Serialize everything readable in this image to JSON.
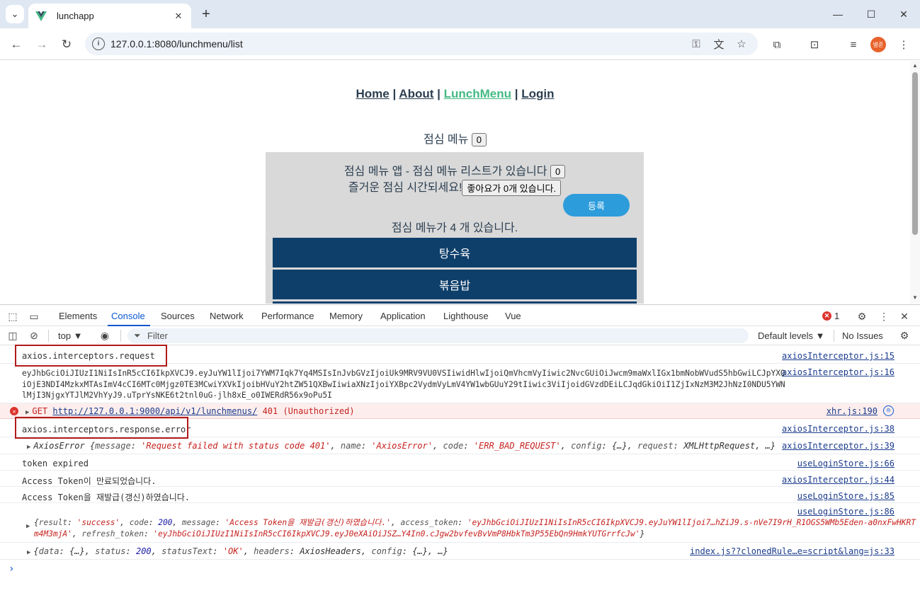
{
  "browser": {
    "tab_title": "lunchapp",
    "url": "127.0.0.1:8080/lunchmenu/list",
    "profile_initials": "병준"
  },
  "page": {
    "nav": [
      "Home",
      "About",
      "LunchMenu",
      "Login"
    ],
    "nav_separator": "|",
    "menu_title": "점심 메뉴",
    "menu_title_count": "0",
    "panel_line1": "점심 메뉴 앱 - 점심 메뉴 리스트가 있습니다",
    "panel_line1_count": "0",
    "panel_line2": "즐거운 점심 시간되세요!",
    "like_button": "좋아요가 0개 있습니다.",
    "register_button": "등록",
    "count_text": "점심 메뉴가 4 개 있습니다.",
    "menu_items": [
      "탕수육",
      "볶음밥"
    ]
  },
  "devtools": {
    "tabs": [
      "Elements",
      "Console",
      "Sources",
      "Network",
      "Performance",
      "Memory",
      "Application",
      "Lighthouse",
      "Vue"
    ],
    "active_tab": "Console",
    "error_count": "1",
    "context": "top ▼",
    "filter_placeholder": "Filter",
    "levels": "Default levels ▼",
    "issues": "No Issues",
    "rows": {
      "r1": {
        "msg": "axios.interceptors.request",
        "src": "axiosInterceptor.js:15"
      },
      "r2": {
        "msg": "eyJhbGciOiJIUzI1NiIsInR5cCI6IkpXVCJ9.eyJuYW1lIjoi7YWM7Iqk7Yq4MSIsInJvbGVzIjoiUk9MRV9VU0VSIiwidHlwIjoiQmVhcmVyIiwic2NvcGUiOiJwcm9maWxlIGx1bmNobWVudS5hbGwiLCJpYXQiOjE3NDI4MzkxMTAsImV4cCI6MTc0Mjgz0TE3MCwiYXVkIjoibHVuY2htZW51QXBwIiwiaXNzIjoiYXBpc2VydmVyLmV4YW1wbGUuY29tIiwic3ViIjoidGVzdDEiLCJqdGkiOiI1ZjIxNzM3M2JhNzI0NDU5YWNlMjI3NjgxYTJlM2VhYyJ9.uTprYsNKE6t2tnl0uG-jlh8xE_o0IWERdR56x9oPu5I",
        "src": "axiosInterceptor.js:16"
      },
      "r3": {
        "prefix": "GET",
        "link": "http://127.0.0.1:9000/api/v1/lunchmenus/",
        "status": "401 (Unauthorized)",
        "src": "xhr.js:190"
      },
      "r4": {
        "msg": "axios.interceptors.response.error",
        "src": "axiosInterceptor.js:38"
      },
      "r5": {
        "name": "AxiosError",
        "k1": "message",
        "v1": "'Request failed with status code 401'",
        "k2": "name",
        "v2": "'AxiosError'",
        "k3": "code",
        "v3": "'ERR_BAD_REQUEST'",
        "k4": "config",
        "v4": "{…}",
        "k5": "request",
        "v5": "XMLHttpRequest",
        "tail": "…}",
        "src": "axiosInterceptor.js:39"
      },
      "r6": {
        "msg": "token expired",
        "src": "useLoginStore.js:66"
      },
      "r7": {
        "msg": "Access Token이 만료되었습니다.",
        "src": "axiosInterceptor.js:44"
      },
      "r8": {
        "msg": "Access Token을 재발급(갱신)하였습니다.",
        "src": "useLoginStore.js:85"
      },
      "r9": {
        "src": "useLoginStore.js:86",
        "k1": "result",
        "v1": "'success'",
        "k2": "code",
        "v2": "200",
        "k3": "message",
        "v3": "'Access Token을 재발급(갱신)하였습니다.'",
        "k4": "access_token",
        "v4": "'eyJhbGciOiJIUzI1NiIsInR5cCI6IkpXVCJ9.eyJuYW1lIjoi7…hZiJ9.s-nVe7I9rH_R1OGS5WMb5Eden-a0nxFwHKRTm4M3mjA'",
        "k5": "refresh_token",
        "v5": "'eyJhbGciOiJIUzI1NiIsInR5cCI6IkpXVCJ9.eyJ0eXAiOiJSZ…Y4In0.cJgw2bvfevBvVmP8HbkTm3P55EbQn9HmkYUTGrrfcJw'"
      },
      "r10": {
        "k1": "data",
        "v1": "{…}",
        "k2": "status",
        "v2": "200",
        "k3": "statusText",
        "v3": "'OK'",
        "k4": "headers",
        "v4": "AxiosHeaders",
        "k5": "config",
        "v5": "{…}",
        "tail": "…}",
        "src": "index.js??clonedRule…e=script&lang=js:33"
      }
    }
  },
  "colors": {
    "accent": "#42b983",
    "menu_item_bg": "#0e3f6b",
    "register_bg": "#2d9cdb",
    "error_red": "#dc362e",
    "highlight_box": "#b21a1a"
  }
}
